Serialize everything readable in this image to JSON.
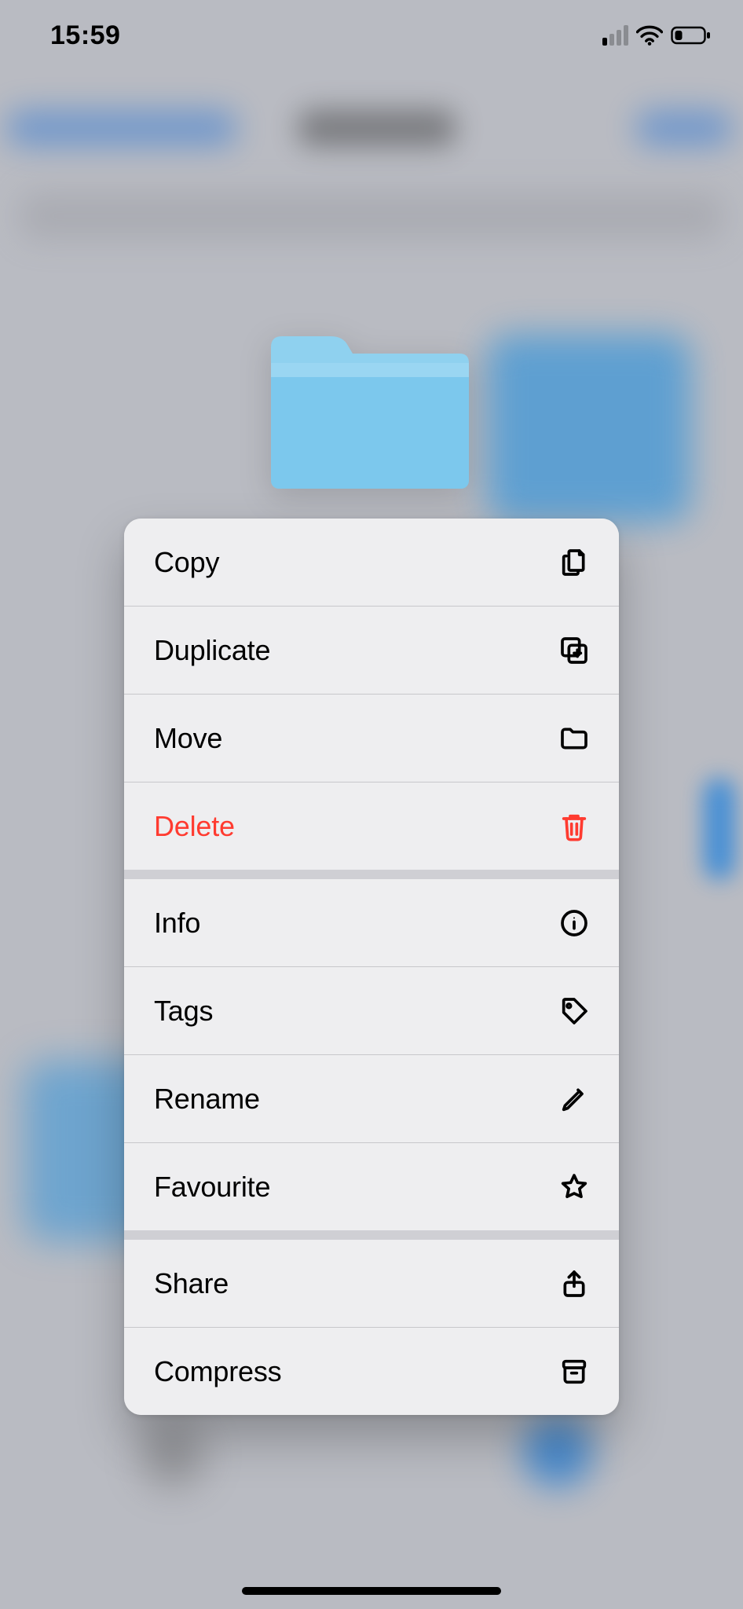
{
  "statusbar": {
    "time": "15:59",
    "cell_signal_active_bars": 1,
    "wifi_strength": 3,
    "battery_level_pct": 20
  },
  "folder_preview": {
    "color": "#7cc8ed"
  },
  "context_menu": {
    "groups": [
      [
        {
          "label": "Copy",
          "icon": "copy-icon",
          "danger": false
        },
        {
          "label": "Duplicate",
          "icon": "duplicate-icon",
          "danger": false
        },
        {
          "label": "Move",
          "icon": "folder-icon",
          "danger": false
        },
        {
          "label": "Delete",
          "icon": "trash-icon",
          "danger": true
        }
      ],
      [
        {
          "label": "Info",
          "icon": "info-icon",
          "danger": false
        },
        {
          "label": "Tags",
          "icon": "tag-icon",
          "danger": false
        },
        {
          "label": "Rename",
          "icon": "pencil-icon",
          "danger": false
        },
        {
          "label": "Favourite",
          "icon": "star-icon",
          "danger": false
        }
      ],
      [
        {
          "label": "Share",
          "icon": "share-icon",
          "danger": false
        },
        {
          "label": "Compress",
          "icon": "archive-icon",
          "danger": false
        }
      ]
    ]
  },
  "colors": {
    "danger": "#ff3b30",
    "menu_bg": "#eeeef0",
    "separator": "#cfcfd4"
  }
}
